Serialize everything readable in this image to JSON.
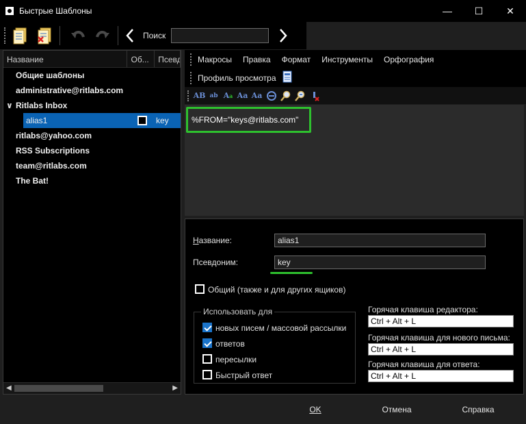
{
  "window": {
    "title": "Быстрые Шаблоны",
    "minimize": "—",
    "maximize": "☐",
    "close": "✕"
  },
  "toolbar": {
    "search_label": "Поиск",
    "search_value": ""
  },
  "left_panel": {
    "columns": [
      "Название",
      "Об...",
      "Псевд"
    ],
    "items": [
      {
        "label": "Общие шаблоны"
      },
      {
        "label": "administrative@ritlabs.com"
      },
      {
        "label": "Ritlabs Inbox",
        "caret": "∨"
      },
      {
        "label": "alias1",
        "alias": "key"
      },
      {
        "label": "ritlabs@yahoo.com"
      },
      {
        "label": "RSS Subscriptions"
      },
      {
        "label": "team@ritlabs.com"
      },
      {
        "label": "The Bat!"
      }
    ]
  },
  "menus": {
    "row1": [
      "Макросы",
      "Правка",
      "Формат",
      "Инструменты",
      "Орфография"
    ],
    "row2": [
      "Профиль просмотра"
    ]
  },
  "editor": {
    "text": "%FROM=\"keys@ritlabs.com\""
  },
  "props": {
    "name_label": "Название:",
    "name_value": "alias1",
    "alias_label": "Псевдоним:",
    "alias_value": "key",
    "shared_label": "Общий (также и для других ящиков)",
    "use_for_title": "Использовать для",
    "use_for": [
      {
        "label": "новых писем / массовой рассылки",
        "checked": true
      },
      {
        "label": "ответов",
        "checked": true
      },
      {
        "label": "пересылки",
        "checked": false
      },
      {
        "label": "Быстрый ответ",
        "checked": false
      }
    ],
    "hotkey_editor_label": "Горячая клавиша редактора:",
    "hotkey_editor_value": "Ctrl + Alt + L",
    "hotkey_new_label": "Горячая клавиша для нового письма:",
    "hotkey_new_value": "Ctrl + Alt + L",
    "hotkey_reply_label": "Горячая клавиша для ответа:",
    "hotkey_reply_value": "Ctrl + Alt + L"
  },
  "buttons": {
    "ok": "OK",
    "cancel": "Отмена",
    "help": "Справка"
  },
  "colors": {
    "accent": "#0a63b4",
    "highlight": "#2ec12e"
  }
}
